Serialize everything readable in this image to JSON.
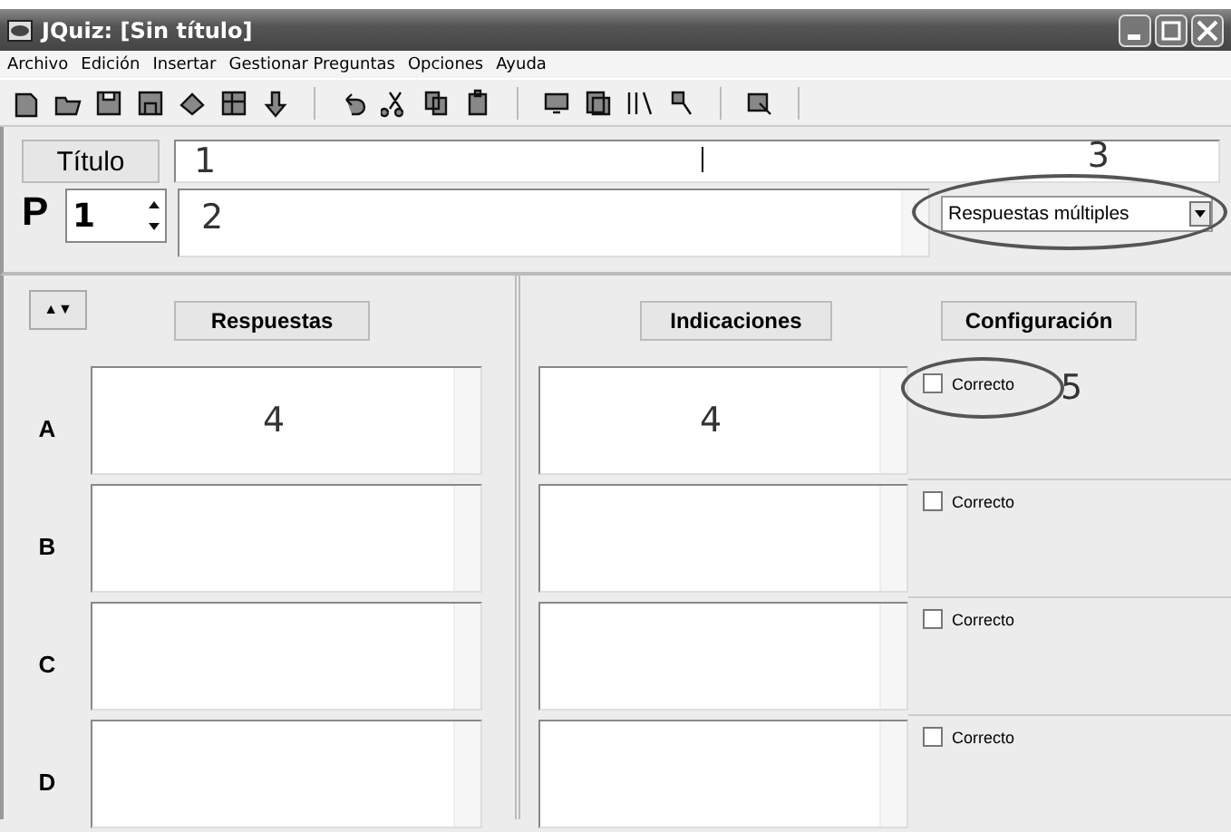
{
  "window": {
    "title": "JQuiz: [Sin título]"
  },
  "menu": [
    "Archivo",
    "Edición",
    "Insertar",
    "Gestionar Preguntas",
    "Opciones",
    "Ayuda"
  ],
  "title_button": "Título",
  "title_field": {
    "value": "1"
  },
  "title_annotation": "3",
  "question": {
    "prefix": "P",
    "number": "1",
    "text": "2",
    "type": "Respuestas múltiples"
  },
  "headers": {
    "sort_arrows": "▲▼",
    "answers": "Respuestas",
    "hints": "Indicaciones",
    "settings": "Configuración"
  },
  "rows": [
    {
      "letter": "A",
      "answer": "4",
      "hint": "4",
      "correct_label": "Correcto",
      "checked": false,
      "annotation": "5"
    },
    {
      "letter": "B",
      "answer": "",
      "hint": "",
      "correct_label": "Correcto",
      "checked": false
    },
    {
      "letter": "C",
      "answer": "",
      "hint": "",
      "correct_label": "Correcto",
      "checked": false
    },
    {
      "letter": "D",
      "answer": "",
      "hint": "",
      "correct_label": "Correcto",
      "checked": false
    }
  ]
}
